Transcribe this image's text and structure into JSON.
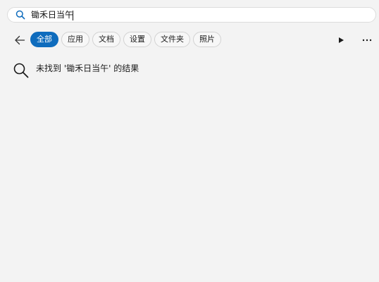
{
  "search": {
    "value": "锄禾日当午",
    "icon": "search-icon"
  },
  "filters": {
    "items": [
      {
        "label": "全部",
        "active": true
      },
      {
        "label": "应用",
        "active": false
      },
      {
        "label": "文档",
        "active": false
      },
      {
        "label": "设置",
        "active": false
      },
      {
        "label": "文件夹",
        "active": false
      },
      {
        "label": "照片",
        "active": false
      }
    ]
  },
  "results": {
    "empty_message": "未找到 '锄禾日当午' 的结果",
    "icon": "search-icon"
  },
  "colors": {
    "accent": "#0f6cbd",
    "background": "#f3f3f3"
  }
}
